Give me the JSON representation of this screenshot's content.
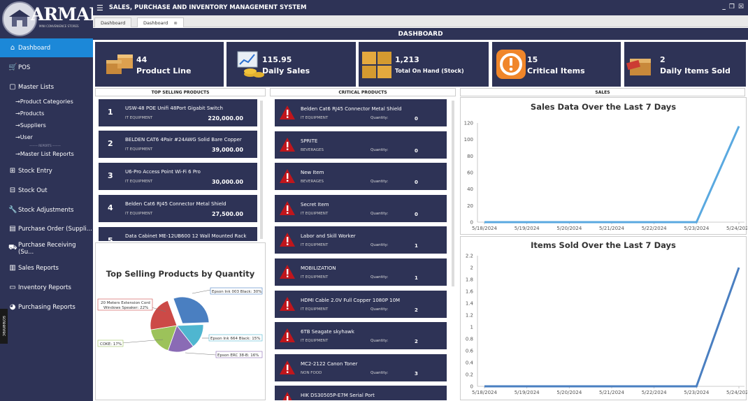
{
  "app": {
    "title": "SALES, PURCHASE AND INVENTORY MANAGEMENT SYSTEM",
    "logo_text": "ARMART",
    "logo_sub": "MINI CONVENIENCE STORES"
  },
  "tabs": [
    {
      "label": "Dashboard"
    },
    {
      "label": "Dashboard",
      "close": "⊗"
    }
  ],
  "sidebar": {
    "items": [
      {
        "label": "Dashboard",
        "icon": "home-icon"
      },
      {
        "label": "POS",
        "icon": "cart-icon"
      },
      {
        "label": "Master Lists",
        "icon": "clipboard-icon"
      },
      {
        "label": "Stock Entry",
        "icon": "plus-box-icon"
      },
      {
        "label": "Stock Out",
        "icon": "minus-box-icon"
      },
      {
        "label": "Stock Adjustments",
        "icon": "wrench-icon"
      },
      {
        "label": "Purchase Order (Suppli...",
        "icon": "order-icon"
      },
      {
        "label": "Purchase Receiving (Su...",
        "icon": "truck-icon"
      },
      {
        "label": "Sales Reports",
        "icon": "bar-chart-icon"
      },
      {
        "label": "Inventory Reports",
        "icon": "inventory-icon"
      },
      {
        "label": "Purchasing Reports",
        "icon": "pie-icon"
      }
    ],
    "sub_items": [
      {
        "label": "→Product Categories"
      },
      {
        "label": "→Products"
      },
      {
        "label": "→Suppliers"
      },
      {
        "label": "→User"
      },
      {
        "label": "→Master List Reports"
      }
    ],
    "reports_divider": "——— REPORTS ———"
  },
  "dashboard_title": "DASHBOARD",
  "cards": [
    {
      "value": "44",
      "label": "Product Line"
    },
    {
      "value": "115.95",
      "label": "Daily Sales"
    },
    {
      "value": "1,213",
      "label": "Total On Hand (Stock)"
    },
    {
      "value": "15",
      "label": "Critical Items"
    },
    {
      "value": "2",
      "label": "Daily Items Sold"
    }
  ],
  "sections": {
    "top_selling": "TOP SELLING PRODUCTS",
    "critical": "CRITICAL PRODUCTS",
    "sales": "SALES"
  },
  "top_selling": [
    {
      "rank": "1",
      "name": "USW-48 POE Unifi 48Port Gigabit Switch",
      "category": "IT EQUIPMENT",
      "amount": "220,000.00"
    },
    {
      "rank": "2",
      "name": "BELDEN CAT6 4Pair #24AWG Solid Bare Copper",
      "category": "IT EQUIPMENT",
      "amount": "39,000.00"
    },
    {
      "rank": "3",
      "name": "U6-Pro Access Point Wi-Fi 6 Pro",
      "category": "IT EQUIPMENT",
      "amount": "30,000.00"
    },
    {
      "rank": "4",
      "name": "Belden Cat6 RJ45 Connector Metal Shield",
      "category": "IT EQUIPMENT",
      "amount": "27,500.00"
    },
    {
      "rank": "5",
      "name": "Data Cabinet ME-12UB600 12 Wall Mounted Rack",
      "category": "",
      "amount": ""
    }
  ],
  "critical": {
    "qty_label": "Quantity:",
    "items": [
      {
        "name": "Belden Cat6 RJ45 Connector Metal Shield",
        "category": "IT EQUIPMENT",
        "qty": "0"
      },
      {
        "name": "SPRITE",
        "category": "BEVERAGES",
        "qty": "0"
      },
      {
        "name": "New Item",
        "category": "BEVERAGES",
        "qty": "0"
      },
      {
        "name": "Secret Item",
        "category": "IT EQUIPMENT",
        "qty": "0"
      },
      {
        "name": "Labor and Skill Worker",
        "category": "IT EQUIPMENT",
        "qty": "1"
      },
      {
        "name": "MOBILIZATION",
        "category": "IT EQUIPMENT",
        "qty": "1"
      },
      {
        "name": "HDMI Cable 2.0V Full Copper 1080P 10M",
        "category": "IT EQUIPMENT",
        "qty": "2"
      },
      {
        "name": "6TB Seagate skyhawk",
        "category": "IT EQUIPMENT",
        "qty": "2"
      },
      {
        "name": "MC2-2122 Canon Toner",
        "category": "NON FOOD",
        "qty": "3"
      },
      {
        "name": "HIK DS30505P-E7M Serial Port",
        "category": "",
        "qty": ""
      }
    ]
  },
  "chart_data": [
    {
      "type": "pie",
      "title": "Top Selling Products by Quantity",
      "slices": [
        {
          "label": "Epson Ink 003 Black: 30%",
          "value": 30,
          "color": "#4a7fc1"
        },
        {
          "label": "Epson Ink 664 Black: 15%",
          "value": 15,
          "color": "#4fb6d0"
        },
        {
          "label": "Epson ERC 38-B: 16%",
          "value": 16,
          "color": "#8a6bb5"
        },
        {
          "label": "COKE: 17%",
          "value": 17,
          "color": "#9cc25a"
        },
        {
          "label": "20 Meters Extension Cord Windows Speaker: 22%",
          "value": 22,
          "color": "#cc4a47"
        }
      ],
      "legend_labels": {
        "epson003": "Epson Ink 003 Black: 30%",
        "ext1": "20 Meters Extension Cord",
        "ext2": "Windows Speaker: 22%",
        "epson664": "Epson Ink 664 Black: 15%",
        "coke": "COKE: 17%",
        "erc": "Epson ERC 38-B: 16%"
      }
    },
    {
      "type": "line",
      "title": "Sales Data Over the Last 7 Days",
      "categories": [
        "5/18/2024",
        "5/19/2024",
        "5/20/2024",
        "5/21/2024",
        "5/22/2024",
        "5/23/2024",
        "5/24/2024"
      ],
      "values": [
        0,
        0,
        0,
        0,
        0,
        0,
        115.95
      ],
      "ylim": [
        0,
        120
      ],
      "yticks": [
        "0",
        "20",
        "40",
        "60",
        "80",
        "100",
        "120"
      ],
      "color": "#5aa9e0"
    },
    {
      "type": "line",
      "title": "Items Sold Over the Last 7 Days",
      "categories": [
        "5/18/2024",
        "5/19/2024",
        "5/20/2024",
        "5/21/2024",
        "5/22/2024",
        "5/23/2024",
        "5/24/2024"
      ],
      "values": [
        0,
        0,
        0,
        0,
        0,
        0,
        2
      ],
      "ylim": [
        0,
        2.2
      ],
      "yticks": [
        "0",
        "0.2",
        "0.4",
        "0.6",
        "0.8",
        "1",
        "1.2",
        "1.4",
        "1.6",
        "1.8",
        "2",
        "2.2"
      ],
      "color": "#4a7fc1"
    }
  ],
  "watermark": "screenrec"
}
